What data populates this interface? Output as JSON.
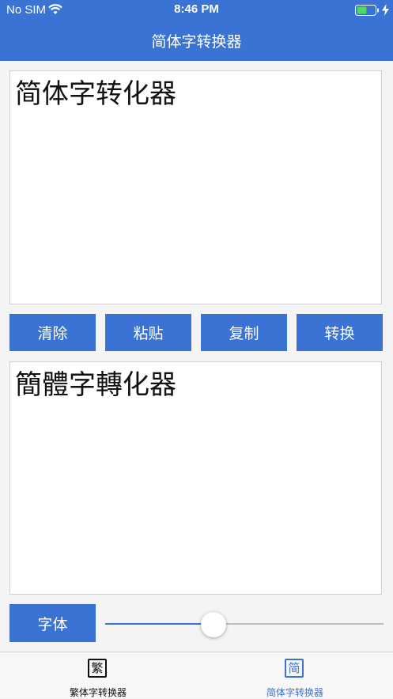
{
  "status_bar": {
    "carrier": "No SIM",
    "time": "8:46 PM",
    "battery_color": "#4cd964"
  },
  "nav": {
    "title": "简体字转换器"
  },
  "input": {
    "text": "简体字转化器"
  },
  "buttons": {
    "clear": "清除",
    "paste": "粘贴",
    "copy": "复制",
    "convert": "转换"
  },
  "output": {
    "text": "簡體字轉化器"
  },
  "font_control": {
    "label": "字体",
    "slider_value": 0.39
  },
  "tabbar": {
    "items": [
      {
        "icon_char": "繁",
        "label": "繁体字转换器",
        "selected": false
      },
      {
        "icon_char": "简",
        "label": "简体字转换器",
        "selected": true
      }
    ]
  },
  "colors": {
    "accent": "#3a73d3",
    "background": "#f4f4f4"
  },
  "icons": [
    "wifi-icon",
    "battery-icon",
    "charge-icon"
  ]
}
